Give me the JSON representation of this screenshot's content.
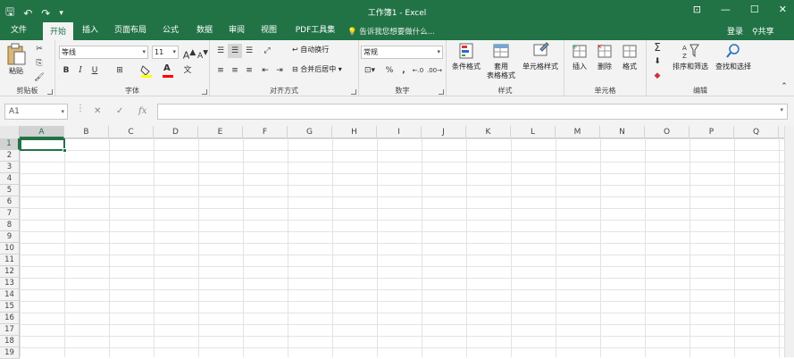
{
  "titlebar": {
    "title": "工作簿1 - Excel",
    "qat": {
      "save": "🖫",
      "undo": "↶",
      "redo": "↷",
      "customize": "▾"
    },
    "win": {
      "ribbon_opts": "⊡",
      "minimize": "—",
      "maximize": "☐",
      "close": "✕"
    }
  },
  "tabs": [
    "文件",
    "开始",
    "插入",
    "页面布局",
    "公式",
    "数据",
    "审阅",
    "视图",
    "PDF工具集"
  ],
  "tell_me": "告诉我您想要做什么...",
  "signin": "登录",
  "share": "共享",
  "clipboard": {
    "paste": "粘贴",
    "group": "剪贴板"
  },
  "font": {
    "name": "等线",
    "size": "11",
    "grow": "A",
    "shrink": "A",
    "bold": "B",
    "italic": "I",
    "underline": "U",
    "color_letter": "A",
    "group": "字体",
    "fill_color": "#ffff00",
    "font_color": "#ff0000"
  },
  "alignment": {
    "wrap": "自动换行",
    "merge": "合并后居中",
    "group": "对齐方式"
  },
  "number": {
    "format": "常规",
    "percent": "%",
    "comma": ",",
    "group": "数字"
  },
  "styles": {
    "conditional": "条件格式",
    "table_1": "套用",
    "table_2": "表格格式",
    "cell_styles": "单元格样式",
    "group": "样式"
  },
  "cells_group": {
    "insert": "插入",
    "delete": "删除",
    "format": "格式",
    "group": "单元格"
  },
  "editing": {
    "sort": "排序和筛选",
    "find": "查找和选择",
    "group": "编辑"
  },
  "formula_bar": {
    "namebox": "A1",
    "cancel": "✕",
    "enter": "✓",
    "fx": "fx",
    "value": ""
  },
  "columns": [
    "A",
    "B",
    "C",
    "D",
    "E",
    "F",
    "G",
    "H",
    "I",
    "J",
    "K",
    "L",
    "M",
    "N",
    "O",
    "P",
    "Q"
  ],
  "rows": [
    "1",
    "2",
    "3",
    "4",
    "5",
    "6",
    "7",
    "8",
    "9",
    "10",
    "11",
    "12",
    "13",
    "14",
    "15",
    "16",
    "17",
    "18",
    "19"
  ],
  "colors": {
    "accent": "#217346"
  }
}
